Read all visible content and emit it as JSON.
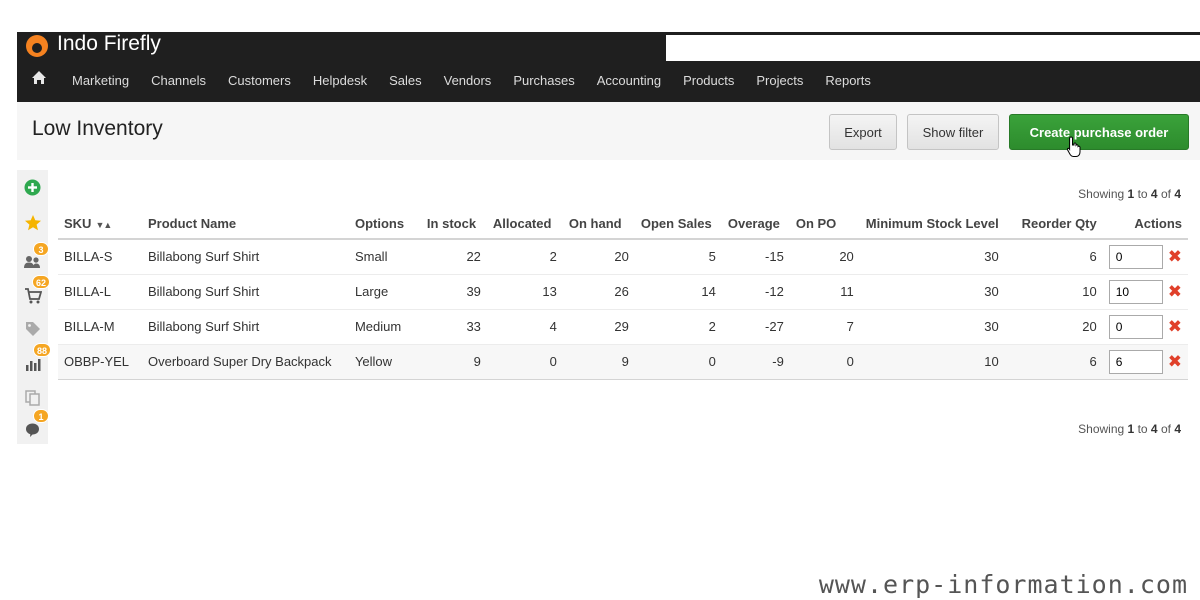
{
  "app": {
    "brand": "Indo Firefly"
  },
  "nav": {
    "home_icon": "home-icon",
    "items": [
      "Marketing",
      "Channels",
      "Customers",
      "Helpdesk",
      "Sales",
      "Vendors",
      "Purchases",
      "Accounting",
      "Products",
      "Projects",
      "Reports"
    ]
  },
  "page": {
    "title": "Low Inventory"
  },
  "toolbar": {
    "export_label": "Export",
    "filter_label": "Show filter",
    "create_label": "Create purchase order"
  },
  "sidebar": {
    "items": [
      {
        "icon": "add-icon"
      },
      {
        "icon": "star-icon"
      },
      {
        "icon": "users-icon",
        "badge": "3"
      },
      {
        "icon": "cart-icon",
        "badge": "62"
      },
      {
        "icon": "tag-icon"
      },
      {
        "icon": "chart-icon",
        "badge": "88"
      },
      {
        "icon": "copy-icon"
      },
      {
        "icon": "chat-icon",
        "badge": "1"
      }
    ]
  },
  "pagination": {
    "prefix": "Showing",
    "from": "1",
    "to_word": "to",
    "to": "4",
    "of_word": "of",
    "total": "4"
  },
  "table": {
    "columns": [
      "SKU",
      "Product Name",
      "Options",
      "In stock",
      "Allocated",
      "On hand",
      "Open Sales",
      "Overage",
      "On PO",
      "Minimum Stock Level",
      "Reorder Qty",
      "Actions"
    ],
    "rows": [
      {
        "sku": "BILLA-S",
        "name": "Billabong Surf Shirt",
        "option": "Small",
        "in_stock": "22",
        "allocated": "2",
        "on_hand": "20",
        "open_sales": "5",
        "overage": "-15",
        "on_po": "20",
        "min_level": "30",
        "reorder": "6",
        "qty": "0"
      },
      {
        "sku": "BILLA-L",
        "name": "Billabong Surf Shirt",
        "option": "Large",
        "in_stock": "39",
        "allocated": "13",
        "on_hand": "26",
        "open_sales": "14",
        "overage": "-12",
        "on_po": "11",
        "min_level": "30",
        "reorder": "10",
        "qty": "10"
      },
      {
        "sku": "BILLA-M",
        "name": "Billabong Surf Shirt",
        "option": "Medium",
        "in_stock": "33",
        "allocated": "4",
        "on_hand": "29",
        "open_sales": "2",
        "overage": "-27",
        "on_po": "7",
        "min_level": "30",
        "reorder": "20",
        "qty": "0"
      },
      {
        "sku": "OBBP-YEL",
        "name": "Overboard Super Dry Backpack",
        "option": "Yellow",
        "in_stock": "9",
        "allocated": "0",
        "on_hand": "9",
        "open_sales": "0",
        "overage": "-9",
        "on_po": "0",
        "min_level": "10",
        "reorder": "6",
        "qty": "6"
      }
    ]
  },
  "colors": {
    "accent": "#2d8c2d",
    "link": "#1a73b5",
    "badge": "#f5a623",
    "remove": "#e0402a",
    "brand": "#f58220"
  },
  "watermark": "www.erp-information.com"
}
